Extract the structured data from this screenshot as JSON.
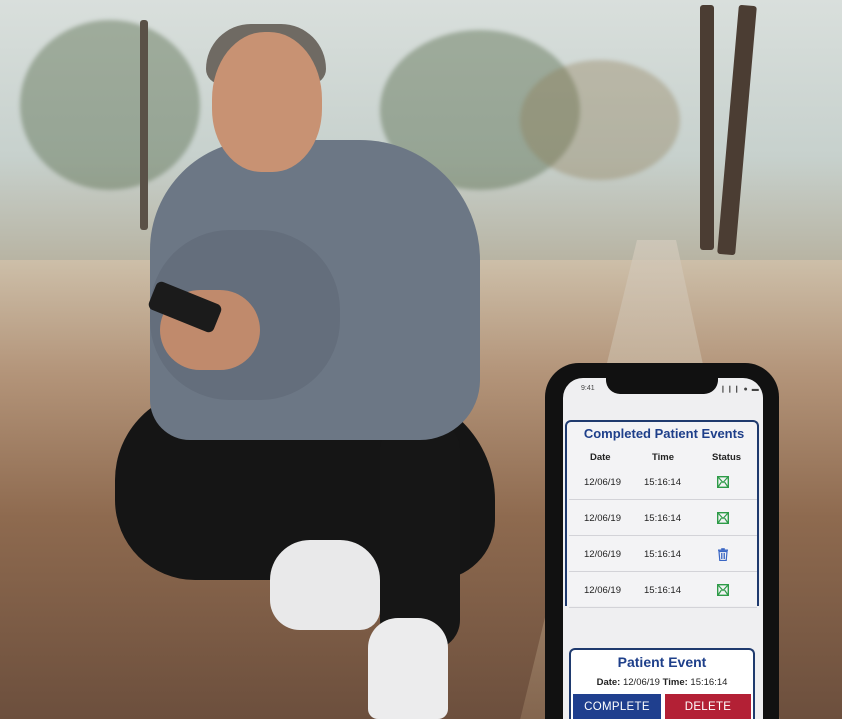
{
  "status_bar": {
    "time": "9:41",
    "icons": "❙❙❙ ● ▬"
  },
  "events_panel": {
    "title": "Completed Patient Events",
    "columns": [
      "Date",
      "Time",
      "Status"
    ],
    "rows": [
      {
        "date": "12/06/19",
        "time": "15:16:14",
        "status_icon": "completed-envelope-icon"
      },
      {
        "date": "12/06/19",
        "time": "15:16:14",
        "status_icon": "completed-envelope-icon"
      },
      {
        "date": "12/06/19",
        "time": "15:16:14",
        "status_icon": "trash-icon"
      },
      {
        "date": "12/06/19",
        "time": "15:16:14",
        "status_icon": "completed-envelope-icon"
      }
    ]
  },
  "event_card": {
    "title": "Patient Event",
    "date_label": "Date:",
    "date_value": "12/06/19",
    "time_label": "Time:",
    "time_value": "15:16:14",
    "complete_label": "COMPLETE",
    "delete_label": "DELETE"
  },
  "colors": {
    "accent_blue": "#1e3f8a",
    "complete_button": "#1f3f8e",
    "delete_button": "#b32035",
    "success_green": "#2e9b48",
    "trash_blue": "#3a66c4"
  }
}
